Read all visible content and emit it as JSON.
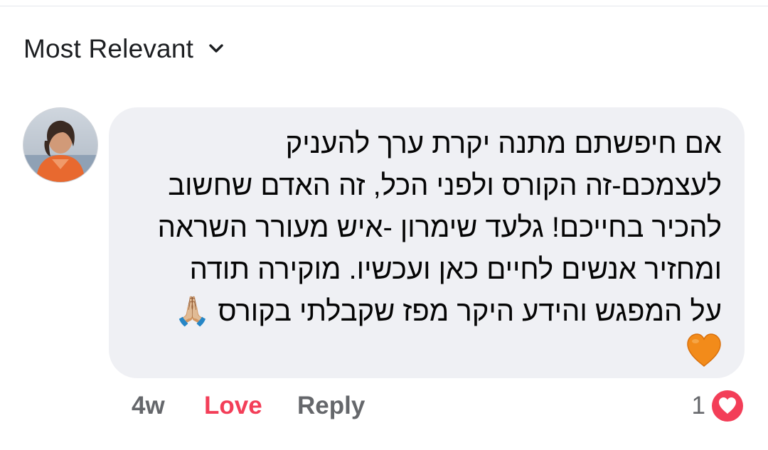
{
  "sort": {
    "label": "Most Relevant",
    "chevron_icon": "chevron-down-icon"
  },
  "comment": {
    "avatar_icon": "user-avatar",
    "lines": [
      "אם חיפשתם מתנה יקרת ערך להעניק",
      "לעצמכם-זה הקורס ולפני הכל, זה האדם שחשוב",
      "להכיר בחייכם! גלעד שימרון -איש מעורר השראה",
      "ומחזיר אנשים לחיים כאן ועכשיו. מוקירה תודה",
      "על המפגש והידע היקר מפז שקבלתי בקורס 🙏🏼"
    ],
    "trailing_emoji": "🧡",
    "time": "4w",
    "reaction_label": "Love",
    "reply_label": "Reply",
    "reaction_count": "1",
    "reaction_icon": "love-reaction-icon",
    "colors": {
      "love": "#f33e58",
      "bubble": "#eff0f4",
      "meta": "#65676b"
    }
  }
}
